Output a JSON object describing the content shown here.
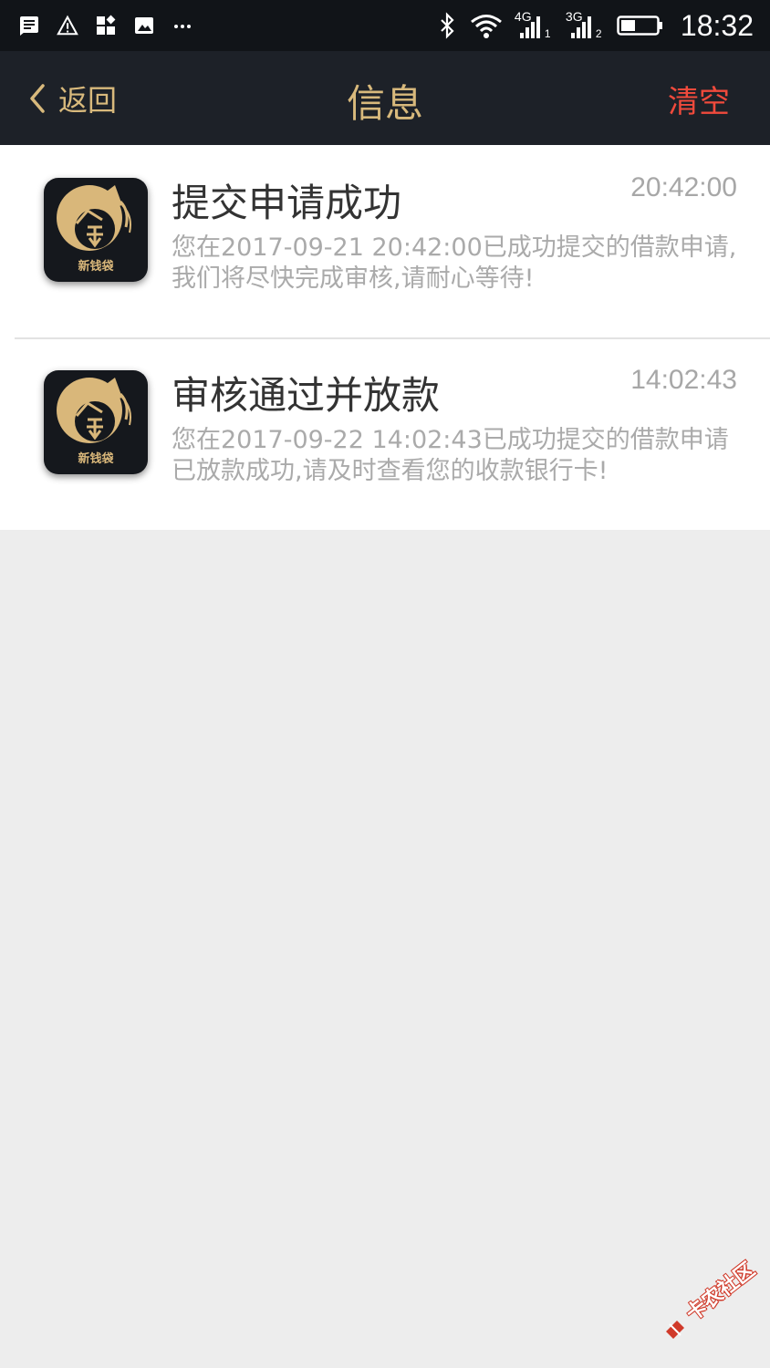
{
  "status_bar": {
    "network_1": "4G",
    "sim_1": "1",
    "network_2": "3G",
    "sim_2": "2",
    "time": "18:32",
    "battery_level": 0.4
  },
  "nav": {
    "back_label": "返回",
    "title": "信息",
    "clear_label": "清空",
    "accent_color": "#d8b97c",
    "clear_color": "#f04a3c"
  },
  "messages": [
    {
      "title": "提交申请成功",
      "time": "20:42:00",
      "body": "您在2017-09-21 20:42:00已成功提交的借款申请,我们将尽快完成审核,请耐心等待!",
      "app_name": "新钱袋"
    },
    {
      "title": "审核通过并放款",
      "time": "14:02:43",
      "body": "您在2017-09-22 14:02:43已成功提交的借款申请已放款成功,请及时查看您的收款银行卡!",
      "app_name": "新钱袋"
    }
  ],
  "watermark": {
    "text": "卡农社区"
  }
}
